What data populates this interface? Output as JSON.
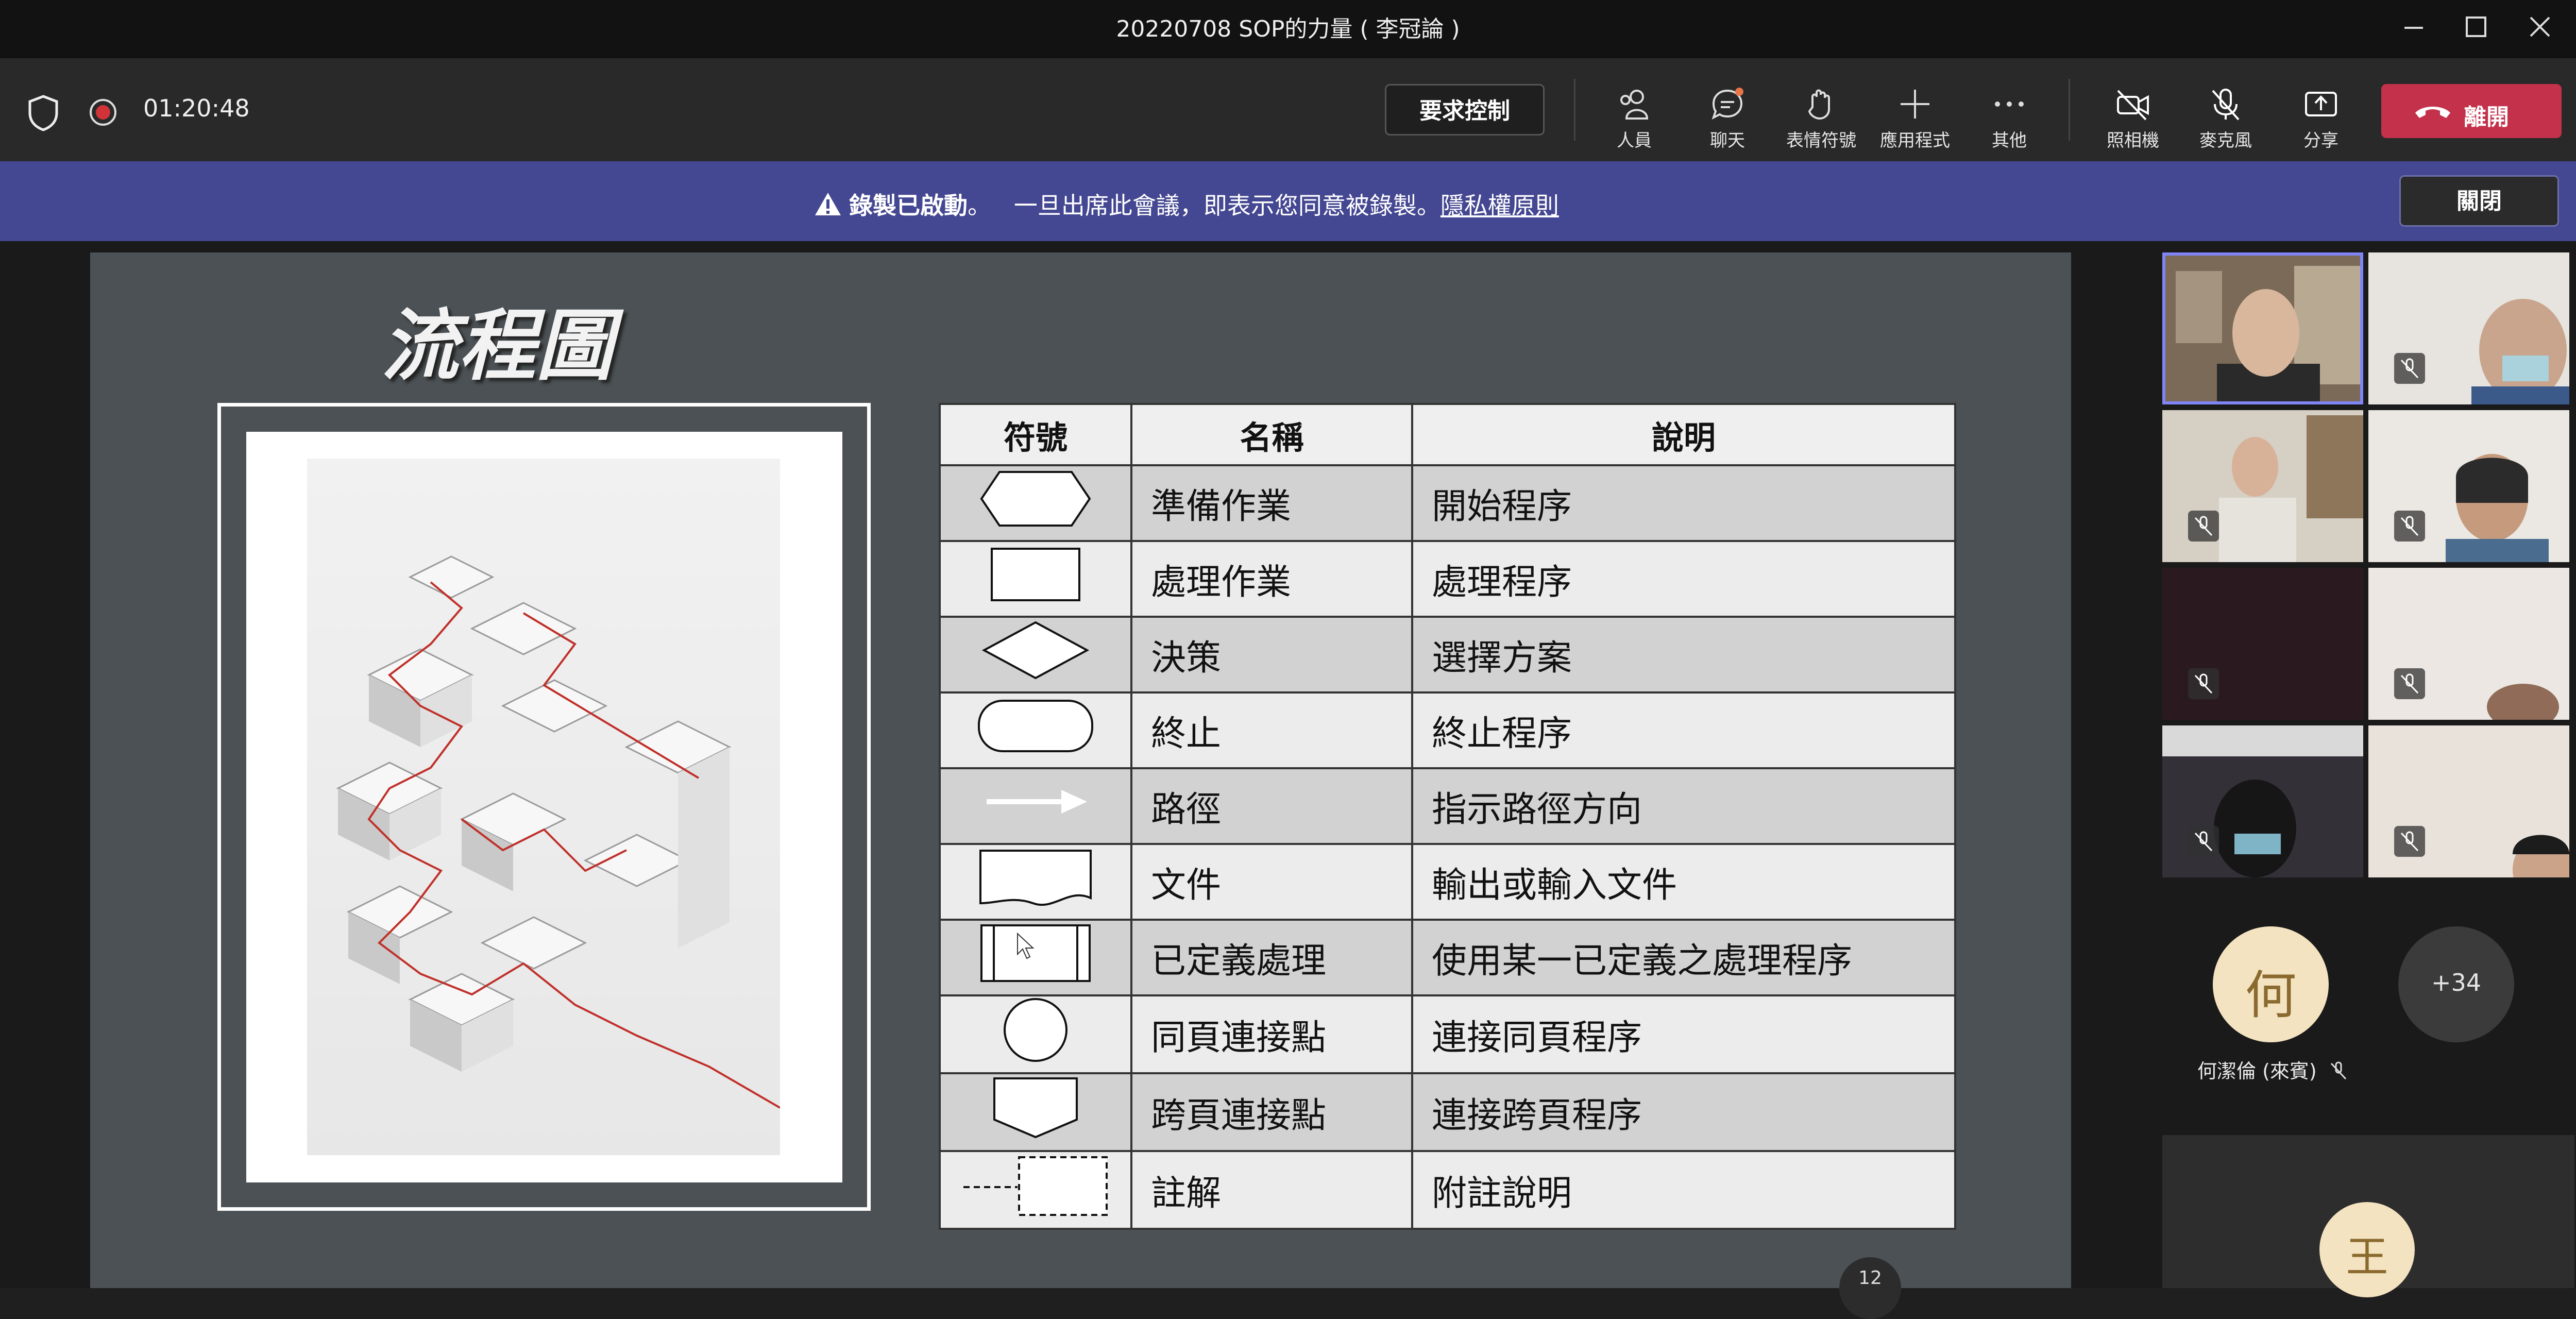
{
  "window": {
    "title": "20220708 SOP的力量 ( 李冠論 )"
  },
  "toolbar": {
    "timer": "01:20:48",
    "request_control": "要求控制",
    "items": [
      {
        "label": "人員",
        "icon": "people-icon"
      },
      {
        "label": "聊天",
        "icon": "chat-icon"
      },
      {
        "label": "表情符號",
        "icon": "reactions-icon"
      },
      {
        "label": "應用程式",
        "icon": "apps-icon"
      },
      {
        "label": "其他",
        "icon": "more-icon"
      },
      {
        "label": "照相機",
        "icon": "camera-off-icon"
      },
      {
        "label": "麥克風",
        "icon": "mic-off-icon"
      },
      {
        "label": "分享",
        "icon": "share-icon"
      }
    ],
    "leave": "離開"
  },
  "banner": {
    "bold": "錄製已啟動",
    "sep": "。",
    "text": "一旦出席此會議，即表示您同意被錄製。",
    "link": "隱私權原則",
    "close": "關閉"
  },
  "slide": {
    "title": "流程圖",
    "table": {
      "headers": [
        "符號",
        "名稱",
        "說明"
      ],
      "rows": [
        {
          "symbol": "hexagon",
          "name": "準備作業",
          "desc": "開始程序"
        },
        {
          "symbol": "rectangle",
          "name": "處理作業",
          "desc": "處理程序"
        },
        {
          "symbol": "diamond",
          "name": "決策",
          "desc": "選擇方案"
        },
        {
          "symbol": "terminator",
          "name": "終止",
          "desc": "終止程序"
        },
        {
          "symbol": "arrow",
          "name": "路徑",
          "desc": "指示路徑方向"
        },
        {
          "symbol": "document",
          "name": "文件",
          "desc": "輸出或輸入文件"
        },
        {
          "symbol": "predefined-process",
          "name": "已定義處理",
          "desc": "使用某一已定義之處理程序"
        },
        {
          "symbol": "circle",
          "name": "同頁連接點",
          "desc": "連接同頁程序"
        },
        {
          "symbol": "offpage-connector",
          "name": "跨頁連接點",
          "desc": "連接跨頁程序"
        },
        {
          "symbol": "annotation",
          "name": "註解",
          "desc": "附註說明"
        }
      ]
    },
    "page_number": "12"
  },
  "gallery": {
    "avatar1_initial": "何",
    "avatar1_name": "何潔倫 (來賓)",
    "more_count": "+34",
    "avatar2_initial": "王"
  },
  "colors": {
    "leave": "#c4314b",
    "banner": "#444791",
    "avatar": "#f4e3c0",
    "record": "#d13438"
  }
}
